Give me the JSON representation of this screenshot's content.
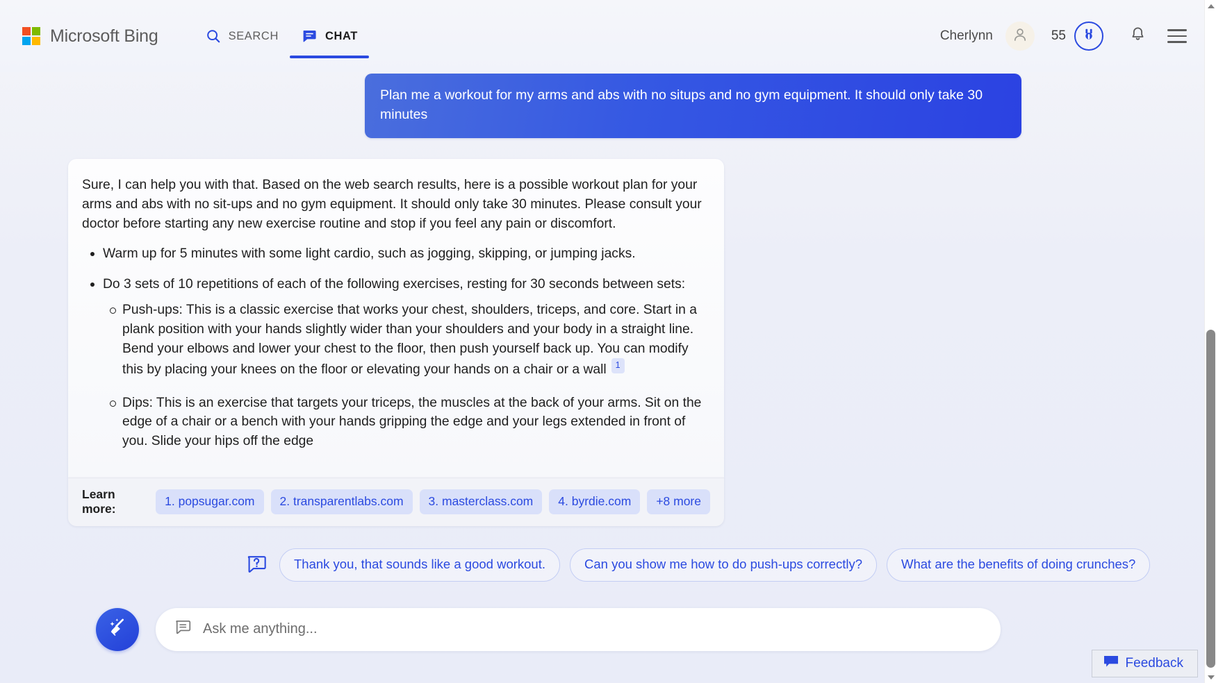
{
  "header": {
    "brand": "Microsoft Bing",
    "logo_icon": "microsoft-logo-icon",
    "nav": [
      {
        "label": "SEARCH",
        "icon": "search-icon",
        "active": false
      },
      {
        "label": "CHAT",
        "icon": "chat-bubble-icon",
        "active": true
      }
    ],
    "user_name": "Cherlynn",
    "avatar_icon": "person-icon",
    "rewards_count": "55",
    "rewards_icon": "rewards-medal-icon",
    "notifications_icon": "bell-icon",
    "menu_icon": "hamburger-menu-icon",
    "accent_color": "#2b4ae0"
  },
  "conversation": {
    "user_message": "Plan me a workout for my arms and abs with no situps and no gym equipment. It should only take 30 minutes",
    "answer": {
      "intro": "Sure, I can help you with that. Based on the web search results, here is a possible workout plan for your arms and abs with no sit-ups and no gym equipment. It should only take 30 minutes. Please consult your doctor before starting any new exercise routine and stop if you feel any pain or discomfort.",
      "bullets": [
        {
          "text": "Warm up for 5 minutes with some light cardio, such as jogging, skipping, or jumping jacks."
        },
        {
          "text": "Do 3 sets of 10 repetitions of each of the following exercises, resting for 30 seconds between sets:"
        }
      ],
      "sub_bullets": [
        {
          "text": "Push-ups: This is a classic exercise that works your chest, shoulders, triceps, and core. Start in a plank position with your hands slightly wider than your shoulders and your body in a straight line. Bend your elbows and lower your chest to the floor, then push yourself back up. You can modify this by placing your knees on the floor or elevating your hands on a chair or a wall",
          "citation": "1"
        },
        {
          "text": "Dips: This is an exercise that targets your triceps, the muscles at the back of your arms. Sit on the edge of a chair or a bench with your hands gripping the edge and your legs extended in front of you. Slide your hips off the edge",
          "citation": ""
        }
      ]
    },
    "learn_more": {
      "label": "Learn more:",
      "sources": [
        "1. popsugar.com",
        "2. transparentlabs.com",
        "3. masterclass.com",
        "4. byrdie.com",
        "+8 more"
      ]
    }
  },
  "suggestions": {
    "icon": "question-bubble-icon",
    "chips": [
      "Thank you, that sounds like a good workout.",
      "Can you show me how to do push-ups correctly?",
      "What are the benefits of doing crunches?"
    ]
  },
  "composer": {
    "new_topic_icon": "broom-sweep-icon",
    "input_icon": "chat-bubble-icon",
    "placeholder": "Ask me anything...",
    "value": ""
  },
  "feedback": {
    "label": "Feedback",
    "icon": "feedback-bubble-icon"
  },
  "scrollbar": {
    "up_icon": "scroll-up-arrow-icon",
    "down_icon": "scroll-down-arrow-icon"
  }
}
